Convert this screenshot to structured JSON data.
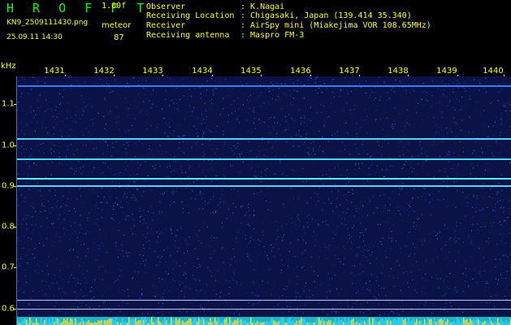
{
  "header": {
    "app_title": "H R O F F T",
    "version": "1.00f",
    "filename": "KN9_2509111430.png",
    "meteor_label": "meteor",
    "datetime": "25.09.11 14:30",
    "meteor_count": "87",
    "info": [
      {
        "key": "Observer",
        "value": ": K.Nagai"
      },
      {
        "key": "Receiving Location",
        "value": ": Chigasaki, Japan (139.414 35.340)"
      },
      {
        "key": "Receiver",
        "value": ": AirSpy mini (Miakejima VOR 108.65MHz)"
      },
      {
        "key": "Receiving antenna",
        "value": ": Maspro FM-3"
      }
    ]
  },
  "axes": {
    "y_unit": "kHz",
    "x_ticks": [
      "1431",
      "1432",
      "1433",
      "1434",
      "1435",
      "1436",
      "1437",
      "1438",
      "1439",
      "1440"
    ],
    "y_ticks": [
      "1.1",
      "1.0",
      "0.9",
      "0.8",
      "0.7",
      "0.6"
    ]
  },
  "colors": {
    "background": "#000000",
    "text": "#ffff00",
    "title": "#00ff00",
    "noise": "#0b1246",
    "signal": "#2fd2ff"
  }
}
